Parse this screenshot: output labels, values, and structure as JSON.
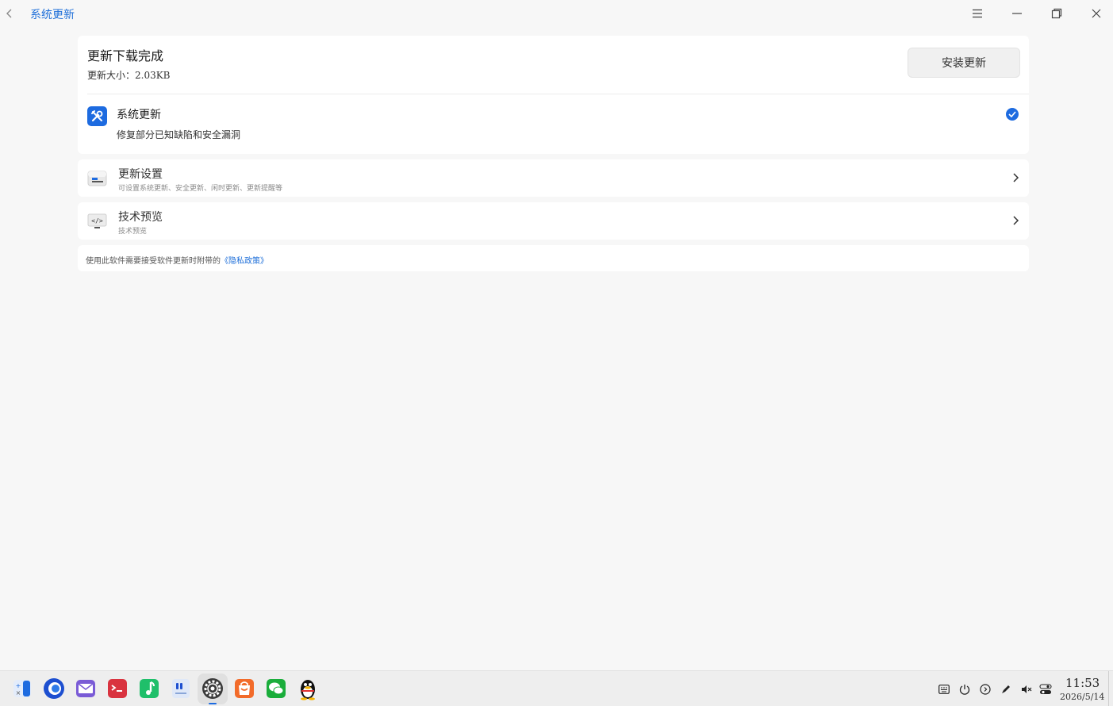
{
  "window": {
    "breadcrumb": "系统更新",
    "controls": [
      "menu-icon",
      "minimize-icon",
      "maximize-icon",
      "close-icon"
    ]
  },
  "download": {
    "title": "更新下载完成",
    "size_label": "更新大小：2.03KB",
    "install_button": "安装更新"
  },
  "system_update": {
    "title": "系统更新",
    "description": "修复部分已知缺陷和安全漏洞",
    "checked": true
  },
  "settings_rows": [
    {
      "title": "更新设置",
      "subtitle": "可设置系统更新、安全更新、闲时更新、更新提醒等",
      "icon": "update-settings-icon"
    },
    {
      "title": "技术预览",
      "subtitle": "技术预览",
      "icon": "code-preview-icon"
    }
  ],
  "footer": {
    "text": "使用此软件需要接受软件更新时附带的",
    "link": "《隐私政策》"
  },
  "taskbar": {
    "apps": [
      "launcher",
      "browser",
      "mail",
      "terminal",
      "music",
      "text-editor",
      "settings",
      "app-store",
      "wechat",
      "qq"
    ],
    "active_app": "settings",
    "tray": [
      "keyboard-icon",
      "power-icon",
      "media-icon",
      "pen-icon",
      "volume-muted-icon",
      "toggle-icon"
    ],
    "time": "11:53",
    "date": "2026/5/14"
  },
  "colors": {
    "accent": "#1d6be0",
    "background": "#f7f7f7",
    "card": "#ffffff"
  }
}
